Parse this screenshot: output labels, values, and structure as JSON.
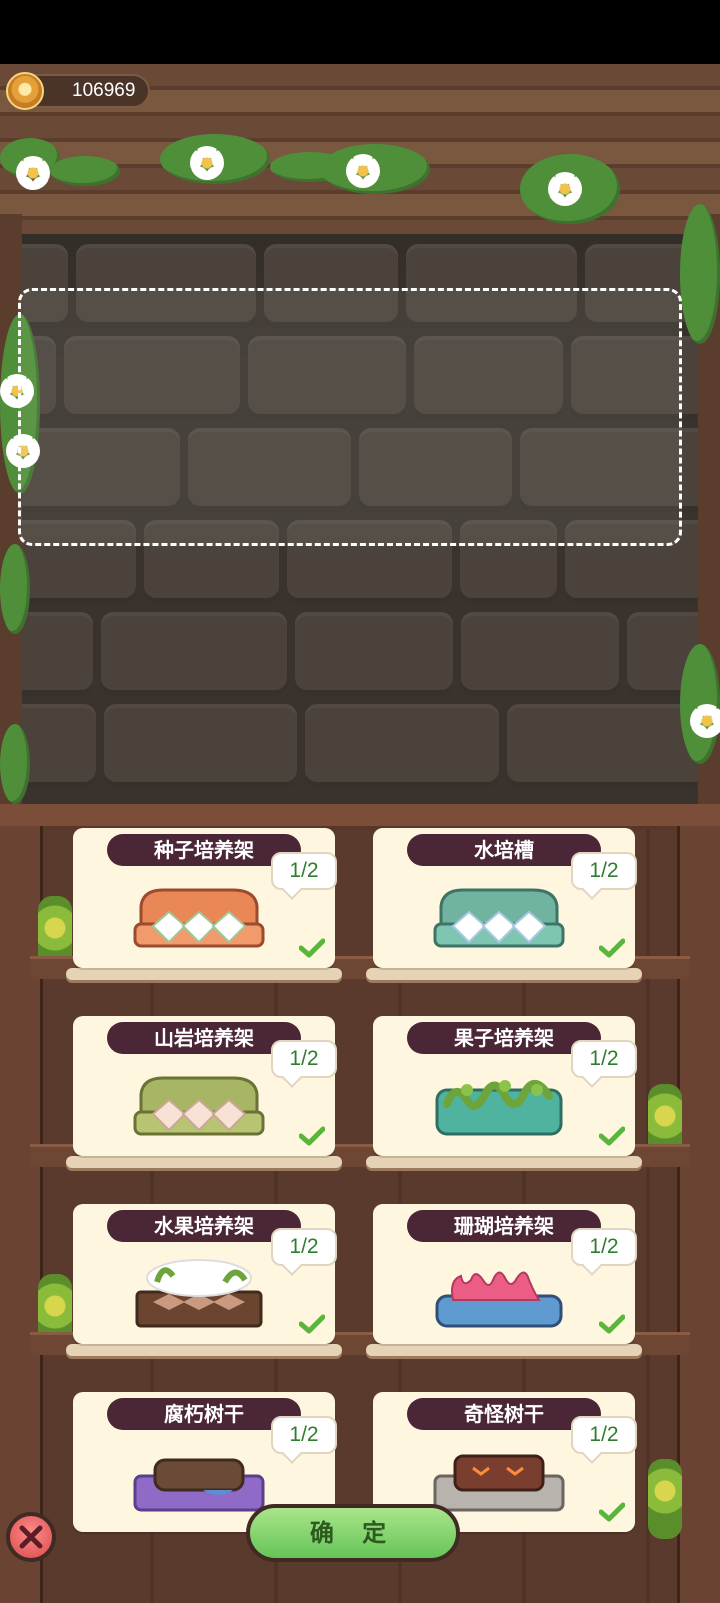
{
  "header": {
    "coin_value": "106969"
  },
  "footer": {
    "confirm_label": "确 定"
  },
  "shelf_items": [
    {
      "title": "种子培养架",
      "count": "1/2",
      "art": "orange",
      "completed": true
    },
    {
      "title": "水培槽",
      "count": "1/2",
      "art": "teal",
      "completed": true
    },
    {
      "title": "山岩培养架",
      "count": "1/2",
      "art": "olive",
      "completed": true
    },
    {
      "title": "果子培养架",
      "count": "1/2",
      "art": "vine",
      "completed": true
    },
    {
      "title": "水果培养架",
      "count": "1/2",
      "art": "fruit",
      "completed": true
    },
    {
      "title": "珊瑚培养架",
      "count": "1/2",
      "art": "coral",
      "completed": true
    },
    {
      "title": "腐朽树干",
      "count": "1/2",
      "art": "log-purple",
      "completed": false
    },
    {
      "title": "奇怪树干",
      "count": "1/2",
      "art": "log-red",
      "completed": true
    }
  ],
  "colors": {
    "title_bg": "#4a2636",
    "count_text": "#2f7e2f",
    "confirm_bg": "#66c457",
    "check": "#5ab53c"
  }
}
